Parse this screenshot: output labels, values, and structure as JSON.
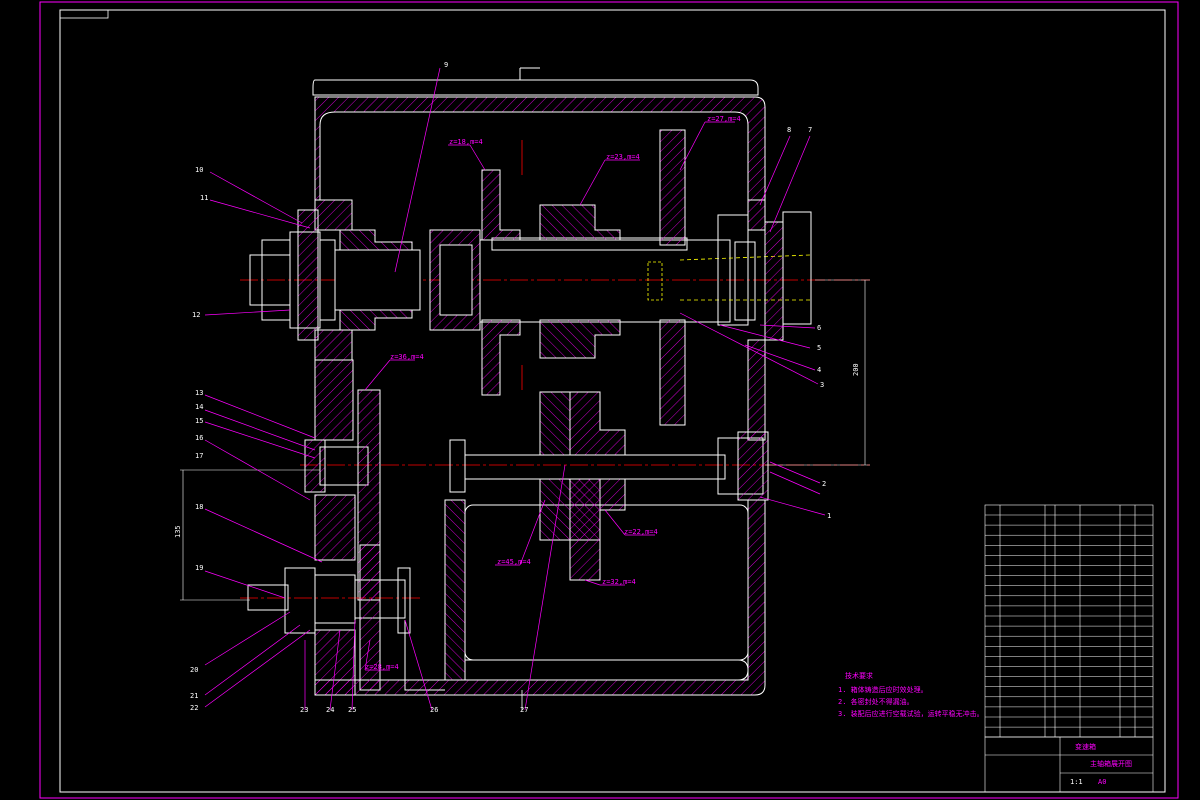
{
  "colors": {
    "background": "#000000",
    "border": "#ff00ff",
    "outline": "#ffffff",
    "hatch": "#ff00ff",
    "centerline": "#ff0000",
    "hidden": "#ffff00",
    "leader": "#ff00ff"
  },
  "dimensions": {
    "center_distance_top": "200",
    "center_distance_bottom": "135"
  },
  "gear_labels": {
    "g1": "z=27,m=4",
    "g2": "z=18,m=4",
    "g3": "z=23,m=4",
    "g4": "z=36,m=4",
    "g5": "z=45,m=4",
    "g6": "z=22,m=4",
    "g7": "z=32,m=4",
    "g8": "z=28,m=4"
  },
  "part_numbers": {
    "right": [
      "8",
      "7",
      "6",
      "5",
      "4",
      "3",
      "2",
      "1"
    ],
    "left": [
      "10",
      "11",
      "12",
      "13",
      "14",
      "15",
      "16",
      "17",
      "18",
      "19",
      "20",
      "21",
      "22"
    ],
    "bottom": [
      "23",
      "24",
      "25",
      "26",
      "27"
    ],
    "top": [
      "9"
    ]
  },
  "notes": {
    "heading": "技术要求",
    "items": [
      "1. 箱体铸造后应时效处理。",
      "2. 各密封处不得漏油。",
      "3. 装配后应进行空载试验，运转平稳无冲击。"
    ]
  },
  "title_block": {
    "drawing_name": "主轴箱展开图",
    "company": "变速箱",
    "scale": "1:1",
    "sheet": "A0"
  }
}
